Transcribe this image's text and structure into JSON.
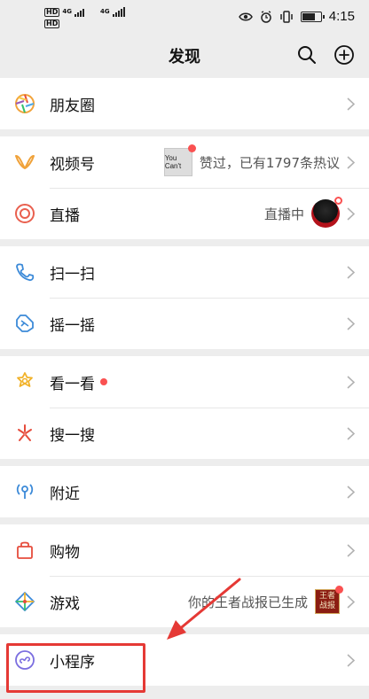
{
  "status_bar": {
    "time": "4:15",
    "network_top": "4G",
    "network_bottom": "4G"
  },
  "header": {
    "title": "发现"
  },
  "groups": [
    {
      "items": [
        {
          "label": "朋友圈",
          "icon": "moments-icon"
        }
      ]
    },
    {
      "items": [
        {
          "label": "视频号",
          "icon": "channels-icon",
          "subtitle": "赞过，已有1797条热议",
          "thumbnail_text": "You Can't"
        },
        {
          "label": "直播",
          "icon": "live-icon",
          "subtitle": "直播中"
        }
      ]
    },
    {
      "items": [
        {
          "label": "扫一扫",
          "icon": "scan-icon"
        },
        {
          "label": "摇一摇",
          "icon": "shake-icon"
        }
      ]
    },
    {
      "items": [
        {
          "label": "看一看",
          "icon": "top-stories-icon",
          "badge": "red-dot"
        },
        {
          "label": "搜一搜",
          "icon": "search-feature-icon"
        }
      ]
    },
    {
      "items": [
        {
          "label": "附近",
          "icon": "nearby-icon"
        }
      ]
    },
    {
      "items": [
        {
          "label": "购物",
          "icon": "shopping-icon"
        },
        {
          "label": "游戏",
          "icon": "games-icon",
          "subtitle": "你的王者战报已生成",
          "thumbnail_text": "王者战报"
        }
      ]
    },
    {
      "items": [
        {
          "label": "小程序",
          "icon": "mini-programs-icon"
        }
      ]
    }
  ],
  "annotation": {
    "highlight_color": "#e53935"
  },
  "colors": {
    "background": "#ededed",
    "accent_red": "#fa5151"
  }
}
